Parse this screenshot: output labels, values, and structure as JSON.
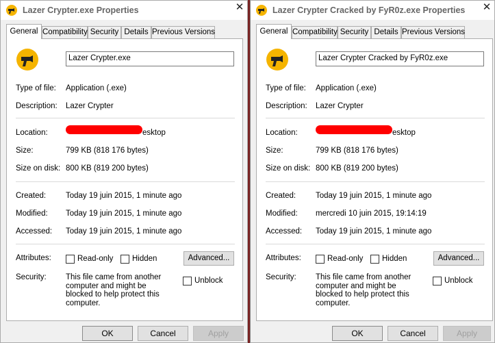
{
  "windows": [
    {
      "title": "Lazer Crypter.exe Properties",
      "close_glyph": "✕",
      "tabs": [
        "General",
        "Compatibility",
        "Security",
        "Details",
        "Previous Versions"
      ],
      "file_name": "Lazer Crypter.exe",
      "type_label": "Type of file:",
      "type_value": "Application (.exe)",
      "description_label": "Description:",
      "description_value": "Lazer Crypter",
      "location_label": "Location:",
      "location_value": "esktop",
      "size_label": "Size:",
      "size_value": "799 KB (818 176 bytes)",
      "size_on_disk_label": "Size on disk:",
      "size_on_disk_value": "800 KB (819 200 bytes)",
      "created_label": "Created:",
      "created_value": "Today 19 juin 2015, 1 minute ago",
      "modified_label": "Modified:",
      "modified_value": "Today 19 juin 2015, 1 minute ago",
      "accessed_label": "Accessed:",
      "accessed_value": "Today 19 juin 2015, 1 minute ago",
      "attributes_label": "Attributes:",
      "readonly_label": "Read-only",
      "hidden_label": "Hidden",
      "advanced_label": "Advanced...",
      "security_label": "Security:",
      "security_text": "This file came from another computer and might be blocked to help protect this computer.",
      "unblock_label": "Unblock",
      "ok_label": "OK",
      "cancel_label": "Cancel",
      "apply_label": "Apply"
    },
    {
      "title": "Lazer Crypter Cracked by FyR0z.exe Properties",
      "close_glyph": "✕",
      "tabs": [
        "General",
        "Compatibility",
        "Security",
        "Details",
        "Previous Versions"
      ],
      "file_name": "Lazer Crypter Cracked by FyR0z.exe",
      "type_label": "Type of file:",
      "type_value": "Application (.exe)",
      "description_label": "Description:",
      "description_value": "Lazer Crypter",
      "location_label": "Location:",
      "location_value": "esktop",
      "size_label": "Size:",
      "size_value": "799 KB (818 176 bytes)",
      "size_on_disk_label": "Size on disk:",
      "size_on_disk_value": "800 KB (819 200 bytes)",
      "created_label": "Created:",
      "created_value": "Today 19 juin 2015, 1 minute ago",
      "modified_label": "Modified:",
      "modified_value": "mercredi 10 juin 2015, 19:14:19",
      "accessed_label": "Accessed:",
      "accessed_value": "Today 19 juin 2015, 1 minute ago",
      "attributes_label": "Attributes:",
      "readonly_label": "Read-only",
      "hidden_label": "Hidden",
      "advanced_label": "Advanced...",
      "security_label": "Security:",
      "security_text": "This file came from another computer and might be blocked to help protect this computer.",
      "unblock_label": "Unblock",
      "ok_label": "OK",
      "cancel_label": "Cancel",
      "apply_label": "Apply"
    }
  ],
  "icons": {
    "app": "hair-dryer-icon",
    "close": "close-icon"
  },
  "colors": {
    "icon_circle": "#f5b400",
    "redaction": "#ff0000",
    "divider": "#7a2424"
  }
}
